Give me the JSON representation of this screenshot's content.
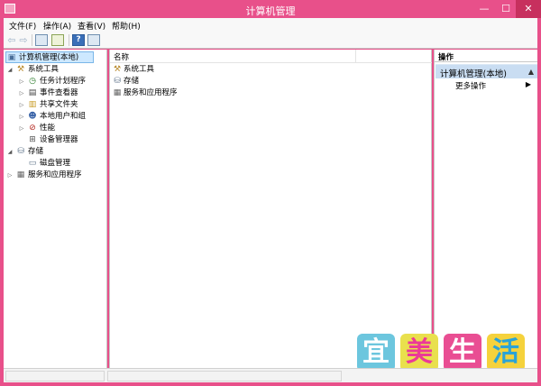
{
  "window": {
    "title": "计算机管理",
    "min_glyph": "—",
    "max_glyph": "☐",
    "close_glyph": "✕"
  },
  "menu": [
    "文件(F)",
    "操作(A)",
    "查看(V)",
    "帮助(H)"
  ],
  "toolbar": {
    "back_glyph": "⇦",
    "forward_glyph": "⇨",
    "help_glyph": "?"
  },
  "tree": {
    "root": "计算机管理(本地)",
    "system_tools": "系统工具",
    "task_scheduler": "任务计划程序",
    "event_viewer": "事件查看器",
    "shared_folders": "共享文件夹",
    "local_users": "本地用户和组",
    "performance": "性能",
    "device_manager": "设备管理器",
    "storage": "存储",
    "disk_management": "磁盘管理",
    "services": "服务和应用程序"
  },
  "center": {
    "column_name": "名称",
    "items": [
      "系统工具",
      "存储",
      "服务和应用程序"
    ]
  },
  "actions": {
    "header": "操作",
    "section": "计算机管理(本地)",
    "more": "更多操作",
    "section_arrow": "▲",
    "more_arrow": "▶"
  },
  "watermark": [
    "宜",
    "美",
    "生",
    "活"
  ],
  "colors": {
    "titlebar": "#e8508a",
    "selection": "#cde8ff",
    "action_section": "#c9ddf2"
  }
}
